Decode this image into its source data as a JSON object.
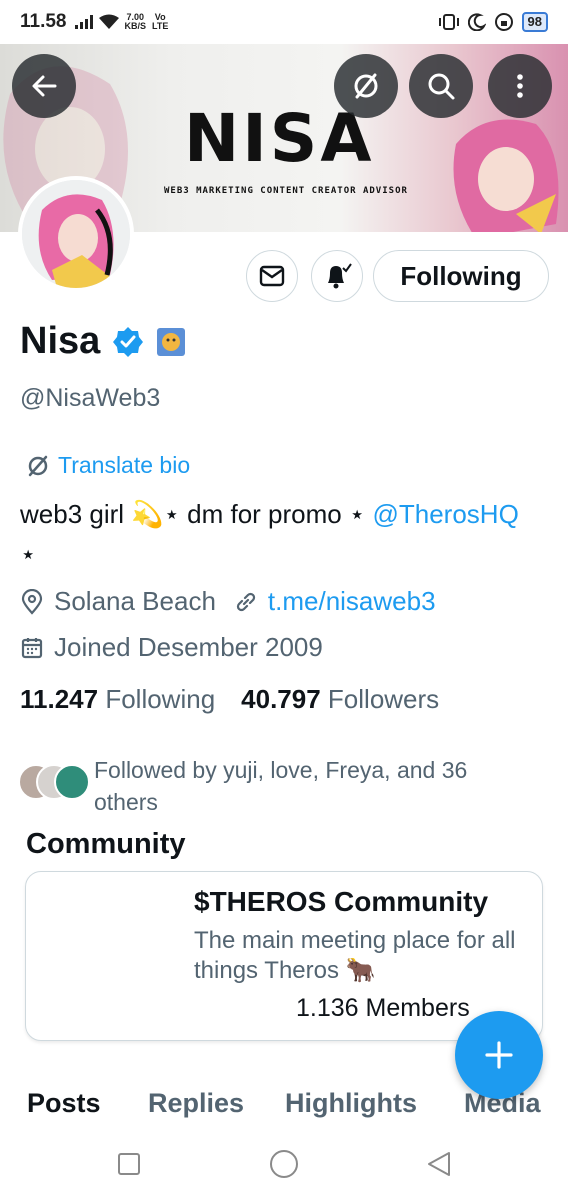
{
  "status_bar": {
    "time": "11.58",
    "net_speed_value": "7.00",
    "net_speed_unit": "KB/S",
    "carrier_top": "Vo",
    "carrier_bottom": "LTE",
    "battery": "98"
  },
  "banner": {
    "logo": "NISA",
    "tagline": "WEB3 MARKETING CONTENT CREATOR ADVISOR"
  },
  "profile": {
    "display_name": "Nisa",
    "handle": "@NisaWeb3",
    "translate_label": "Translate bio",
    "bio_text": "web3 girl 💫⋆ dm for promo ⋆ ",
    "bio_mention": "@TherosHQ",
    "bio_trailing": "⋆",
    "location": "Solana Beach",
    "link": "t.me/nisaweb3",
    "joined": "Joined Desember 2009",
    "following_count": "11.247",
    "following_label": "Following",
    "followers_count": "40.797",
    "followers_label": "Followers",
    "followed_by": "Followed by yuji, love, Freya, and 36 others",
    "follow_button_label": "Following"
  },
  "community": {
    "section_title": "Community",
    "name": "$THEROS Community",
    "description": "The main meeting place for all things Theros 🐂",
    "members": "1.136 Members"
  },
  "tabs": [
    {
      "label": "Posts",
      "active": true
    },
    {
      "label": "Replies",
      "active": false
    },
    {
      "label": "Highlights",
      "active": false
    },
    {
      "label": "Media",
      "active": false
    }
  ],
  "colors": {
    "accent": "#1d9bf0",
    "text_primary": "#0f1419",
    "text_secondary": "#536471",
    "border": "#cfd9de"
  },
  "icons": [
    "back-arrow-icon",
    "translate-icon",
    "search-icon",
    "more-vertical-icon",
    "mail-icon",
    "notification-bell-icon",
    "verified-badge-icon",
    "location-icon",
    "link-icon",
    "calendar-icon",
    "plus-icon"
  ]
}
